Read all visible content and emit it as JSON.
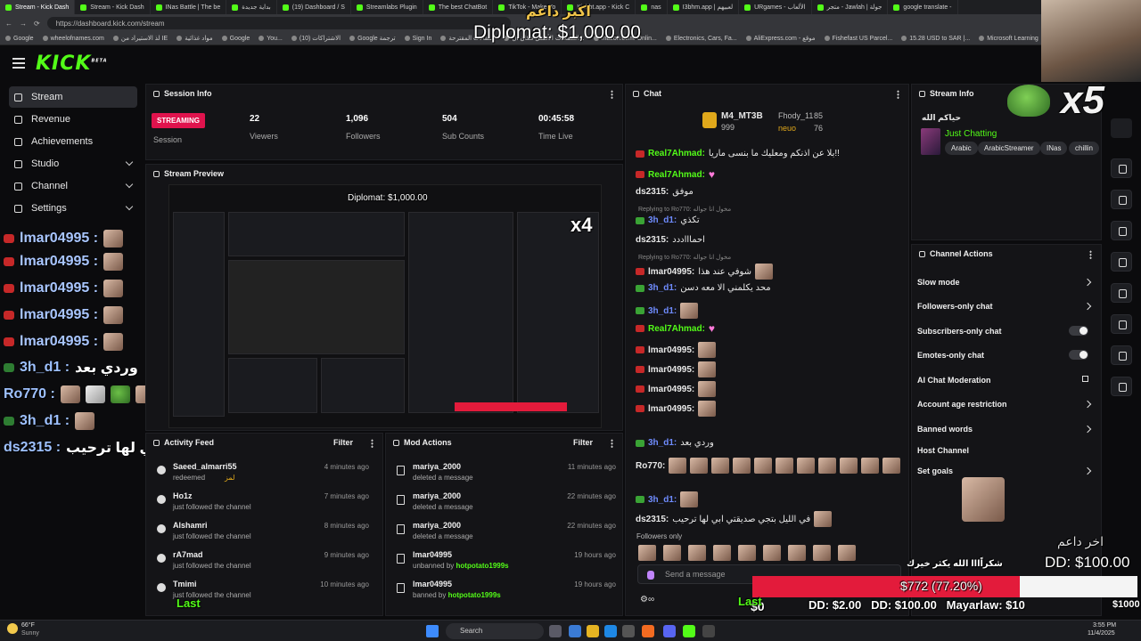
{
  "browser": {
    "tabs": [
      "Stream - Kick Dash",
      "Stream - Kick Dash",
      "INas Battle | The be",
      "بداية جديدة",
      "(19) Dashboard / S",
      "Streamlabs Plugin",
      "The best ChatBot",
      "TikTok - Make Yo",
      "Kickbt.app - Kick C",
      "nas",
      "I3bhm.app | لعبيهم",
      "URgames - الألعاب",
      "متجر - Jawlah | جولة",
      "google translate -"
    ],
    "url": "https://dashboard.kick.com/stream",
    "bookmarks": [
      "Google",
      "wheelofnames.com",
      "لذ الاستيراد من IE",
      "مواد غذائية",
      "Google",
      "You...",
      "الاشتراكات (10)",
      "Google ترجمة",
      "Sign In",
      "المقالات المقترحة",
      "الصفحات الأفضل مكان ال...",
      "mazon.com: Onlin...",
      "Electronics, Cars, Fa...",
      "AliExpress.com - موقع",
      "Fishefast US Parcel...",
      "15.28 USD to SAR |...",
      "Microsoft Learning"
    ]
  },
  "header": {
    "logo": "KICK",
    "logo_sup": "BETA"
  },
  "sidebar": {
    "items": [
      {
        "label": "Stream"
      },
      {
        "label": "Revenue"
      },
      {
        "label": "Achievements"
      },
      {
        "label": "Studio"
      },
      {
        "label": "Channel"
      },
      {
        "label": "Settings"
      }
    ]
  },
  "overlay_chat": [
    {
      "user": "lmar04995 :"
    },
    {
      "user": "lmar04995 :"
    },
    {
      "user": "lmar04995 :"
    },
    {
      "user": "lmar04995 :"
    },
    {
      "user": "lmar04995 :"
    },
    {
      "user": "3h_d1 :",
      "text": "وردي بعد"
    },
    {
      "user": "Ro770 :"
    },
    {
      "user": "3h_d1 :"
    },
    {
      "user": "ds2315 :",
      "text": "في الليل بتجي صديقتي ابي لها ترحيب"
    }
  ],
  "session": {
    "title": "Session Info",
    "badge": "STREAMING",
    "label": "Session",
    "stats": [
      {
        "value": "22",
        "label": "Viewers"
      },
      {
        "value": "1,096",
        "label": "Followers"
      },
      {
        "value": "504",
        "label": "Sub Counts"
      },
      {
        "value": "00:45:58",
        "label": "Time Live"
      }
    ]
  },
  "preview": {
    "title": "Stream Preview"
  },
  "activity": {
    "title": "Activity Feed",
    "filter": "Filter",
    "items": [
      {
        "name": "Saeed_almarri55",
        "desc": "redeemed",
        "extra": "لمز",
        "time": "4 minutes ago"
      },
      {
        "name": "Ho1z",
        "desc": "just followed the channel",
        "time": "7 minutes ago"
      },
      {
        "name": "Alshamri",
        "desc": "just followed the channel",
        "time": "8 minutes ago"
      },
      {
        "name": "rA7mad",
        "desc": "just followed the channel",
        "time": "9 minutes ago"
      },
      {
        "name": "Tmimi",
        "desc": "just followed the channel",
        "time": "10 minutes ago"
      }
    ]
  },
  "mod_actions": {
    "title": "Mod Actions",
    "filter": "Filter",
    "items": [
      {
        "name": "mariya_2000",
        "desc": "deleted a message",
        "time": "11 minutes ago"
      },
      {
        "name": "mariya_2000",
        "desc": "deleted a message",
        "time": "22 minutes ago"
      },
      {
        "name": "mariya_2000",
        "desc": "deleted a message",
        "time": "22 minutes ago"
      },
      {
        "name": "lmar04995",
        "desc": "unbanned by",
        "by": "hotpotato1999s",
        "time": "19 hours ago"
      },
      {
        "name": "lmar04995",
        "desc": "banned by",
        "by": "hotpotato1999s",
        "time": "19 hours ago"
      }
    ]
  },
  "chat": {
    "title": "Chat",
    "leaders": [
      {
        "name": "M4_MT3B",
        "value": "999"
      },
      {
        "name": "Fhody_11",
        "value": "85"
      },
      {
        "name": "neuo",
        "value": "76"
      }
    ],
    "messages": [
      {
        "user": "Real7Ahmad:",
        "text": "بلا عن اذنكم ومعليك ما بنسى ماريا!!",
        "color": "#53fc18"
      },
      {
        "user": "Real7Ahmad:",
        "text": "♥",
        "color": "#53fc18"
      },
      {
        "user": "ds2315:",
        "text": "موفق",
        "color": "#e8e8e8"
      },
      {
        "reply": "Replying to Ro770: مخول انا جواله"
      },
      {
        "user": "3h_d1:",
        "text": "تكذي",
        "color": "#6f8cff"
      },
      {
        "user": "ds2315:",
        "text": "احماااددد",
        "color": "#e8e8e8"
      },
      {
        "reply": "Replying to Ro770: مخول انا جواله"
      },
      {
        "user": "lmar04995:",
        "text": "شوفي عند هذا",
        "color": "#e8e8e8"
      },
      {
        "user": "3h_d1:",
        "text": "محد يكلمني الا معه دسن",
        "color": "#6f8cff"
      },
      {
        "user": "3h_d1:",
        "text": "",
        "color": "#6f8cff"
      },
      {
        "user": "Real7Ahmad:",
        "text": "♥",
        "color": "#53fc18"
      },
      {
        "user": "lmar04995:",
        "text": "",
        "color": "#e8e8e8"
      },
      {
        "user": "lmar04995:",
        "text": "",
        "color": "#e8e8e8"
      },
      {
        "user": "lmar04995:",
        "text": "",
        "color": "#e8e8e8"
      },
      {
        "user": "lmar04995:",
        "text": "",
        "color": "#e8e8e8"
      },
      {
        "user": "3h_d1:",
        "text": "وردي بعد",
        "color": "#6f8cff"
      },
      {
        "user": "Ro770:",
        "text": "",
        "color": "#e8e8e8"
      },
      {
        "user": "3h_d1:",
        "text": "",
        "color": "#6f8cff"
      },
      {
        "user": "ds2315:",
        "text": "في الليل بتجي صديقتي ابي لها ترحيب",
        "color": "#e8e8e8"
      }
    ],
    "followers_only": "Followers only",
    "placeholder": "Send a message"
  },
  "stream_info": {
    "title": "Stream Info",
    "stream_title": "حياكم الله",
    "category": "Just Chatting",
    "tags": [
      "Arabic",
      "ArabicStreamer",
      "INas",
      "chillin"
    ]
  },
  "channel_actions": {
    "title": "Channel Actions",
    "items": [
      {
        "label": "Slow mode",
        "kind": "chevron"
      },
      {
        "label": "Followers-only chat",
        "kind": "chevron"
      },
      {
        "label": "Subscribers-only chat",
        "kind": "toggle"
      },
      {
        "label": "Emotes-only chat",
        "kind": "toggle"
      },
      {
        "label": "AI Chat Moderation",
        "kind": "link"
      },
      {
        "label": "Account age restriction",
        "kind": "chevron"
      },
      {
        "label": "Banned words",
        "kind": "chevron"
      },
      {
        "label": "Host Channel",
        "kind": "none"
      },
      {
        "label": "Set goals",
        "kind": "chevron"
      }
    ]
  },
  "overlays": {
    "top_donor_label": "اكبر داعم",
    "top_donor": "Diplomat: $1,000.00",
    "multiplier": "x5",
    "preview_multiplier": "x4",
    "last_donor_label": "اخر داعم",
    "last_donor": "DD: $100.00",
    "thanks": "شكراًااا الله يكثر خيرك",
    "goal_text": "$772 (77.20%)",
    "goal_progress": 0.772,
    "goal_zero": "$0",
    "goal_max": "$1000",
    "ticker": [
      "DD: $2.00",
      "DD: $100.00",
      "Mayarlaw: $10"
    ],
    "last_word": "Last",
    "colors": {
      "accent": "#53fc18",
      "goal_fill": "#e31b3b",
      "streaming": "#e0134d"
    }
  },
  "taskbar": {
    "weather_temp": "66°F",
    "weather_desc": "Sunny",
    "search": "Search",
    "time": "3:55 PM",
    "date": "11/4/2025"
  }
}
